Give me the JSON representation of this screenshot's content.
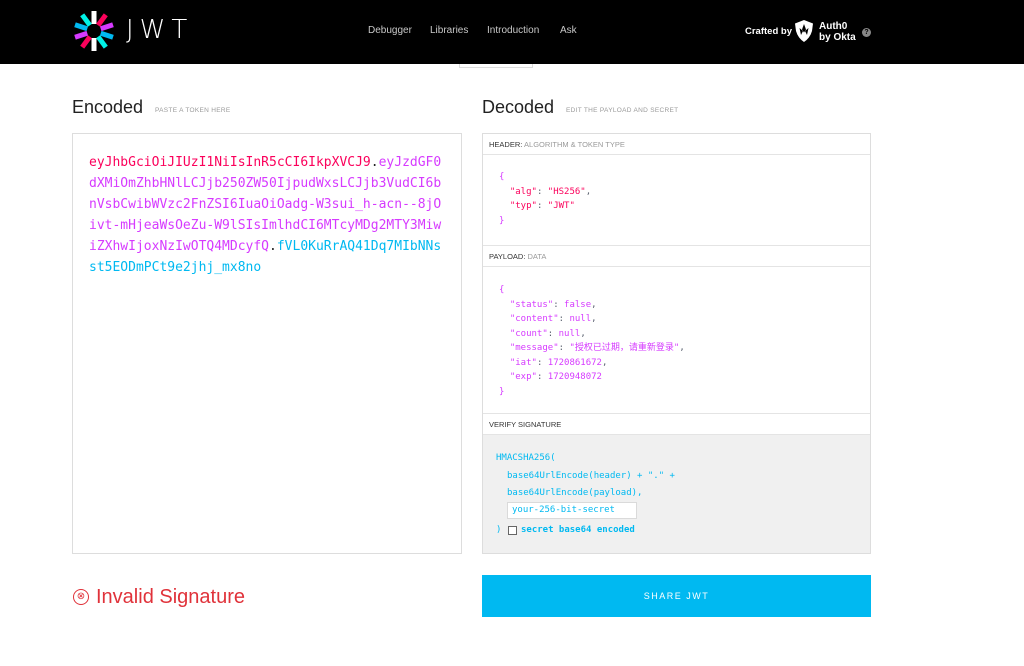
{
  "nav": {
    "logo_text": "JWT",
    "links": [
      "Debugger",
      "Libraries",
      "Introduction",
      "Ask"
    ],
    "crafted_by": "Crafted by",
    "brand_line1": "Auth0",
    "brand_line2": "by Okta",
    "help": "?"
  },
  "encoded": {
    "title": "Encoded",
    "subtitle": "PASTE A TOKEN HERE",
    "token_header": "eyJhbGciOiJIUzI1NiIsInR5cCI6IkpXVCJ9",
    "token_payload": "eyJzdGF0dXMiOmZhbHNlLCJjb250ZW50IjpudWxsLCJjb3VudCI6bnVsbCwibWVzc2FnZSI6IuaOiOadg-W3sui_h-acn--8jOivt-mHjeaWsOeZu-W9lSIsImlhdCI6MTcyMDg2MTY3MiwiZXhwIjoxNzIwOTQ4MDcyfQ",
    "token_signature": "fVL0KuRrAQ41Dq7MIbNNsst5EODmPCt9e2jhj_mx8no",
    "dot": "."
  },
  "decoded": {
    "title": "Decoded",
    "subtitle": "EDIT THE PAYLOAD AND SECRET",
    "header_label": "HEADER:",
    "header_sub": "ALGORITHM & TOKEN TYPE",
    "header_json": {
      "open": "{",
      "close": "}",
      "alg_key": "\"alg\"",
      "alg_val": "\"HS256\"",
      "typ_key": "\"typ\"",
      "typ_val": "\"JWT\""
    },
    "payload_label": "PAYLOAD:",
    "payload_sub": "DATA",
    "payload_json": {
      "open": "{",
      "close": "}",
      "status_key": "\"status\"",
      "status_val": "false",
      "content_key": "\"content\"",
      "content_val": "null",
      "count_key": "\"count\"",
      "count_val": "null",
      "message_key": "\"message\"",
      "message_val": "\"授权已过期，请重新登录\"",
      "iat_key": "\"iat\"",
      "iat_val": "1720861672",
      "exp_key": "\"exp\"",
      "exp_val": "1720948072"
    },
    "verify_label": "VERIFY SIGNATURE",
    "verify": {
      "fn": "HMACSHA256(",
      "line1": "base64UrlEncode(header) + \".\" +",
      "line2": "base64UrlEncode(payload),",
      "secret_placeholder": "your-256-bit-secret",
      "close": ")",
      "checkbox_label": "secret base64 encoded"
    }
  },
  "status": {
    "icon": "⊗",
    "text": "Invalid Signature"
  },
  "share_label": "SHARE JWT",
  "colors": {
    "header": "#fb015b",
    "payload": "#d63aff",
    "signature": "#00b9f1",
    "invalid": "#e0323a"
  }
}
